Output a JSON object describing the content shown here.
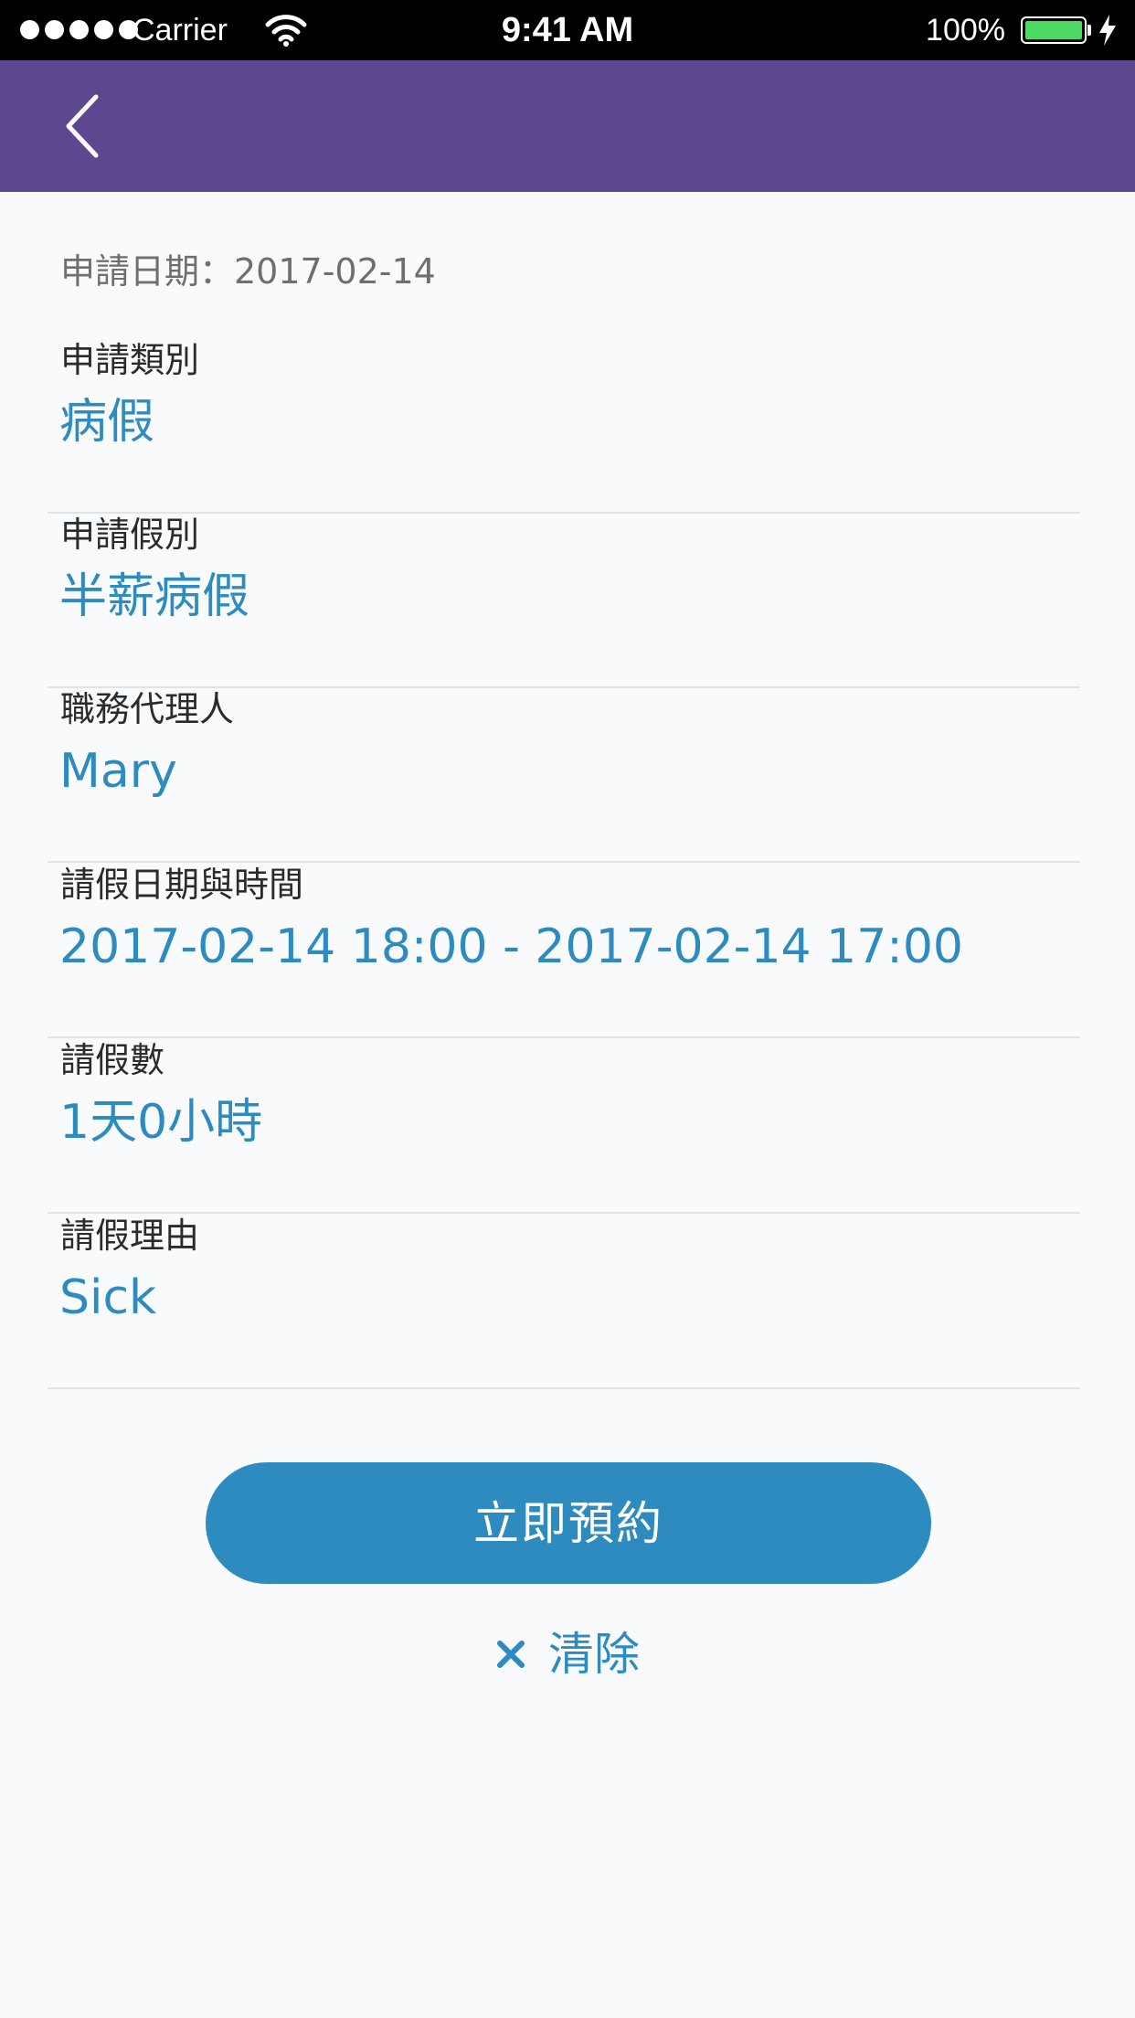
{
  "status_bar": {
    "carrier": "Carrier",
    "time": "9:41 AM",
    "battery": "100%",
    "battery_color": "#4cd964"
  },
  "nav": {
    "background": "#5d478f",
    "back_icon": "chevron-left-icon"
  },
  "form": {
    "apply_date": "申請日期：2017-02-14",
    "fields": [
      {
        "label": "申請類別",
        "value": "病假"
      },
      {
        "label": "申請假別",
        "value": "半薪病假"
      },
      {
        "label": "職務代理人",
        "value": "Mary"
      },
      {
        "label": "請假日期與時間",
        "value": "2017-02-14 18:00 - 2017-02-14 17:00"
      },
      {
        "label": "請假數",
        "value": "1天0小時"
      },
      {
        "label": "請假理由",
        "value": "Sick"
      }
    ]
  },
  "actions": {
    "submit_label": "立即預約",
    "clear_label": "清除",
    "clear_icon": "close-icon",
    "accent": "#2e8bc0"
  }
}
